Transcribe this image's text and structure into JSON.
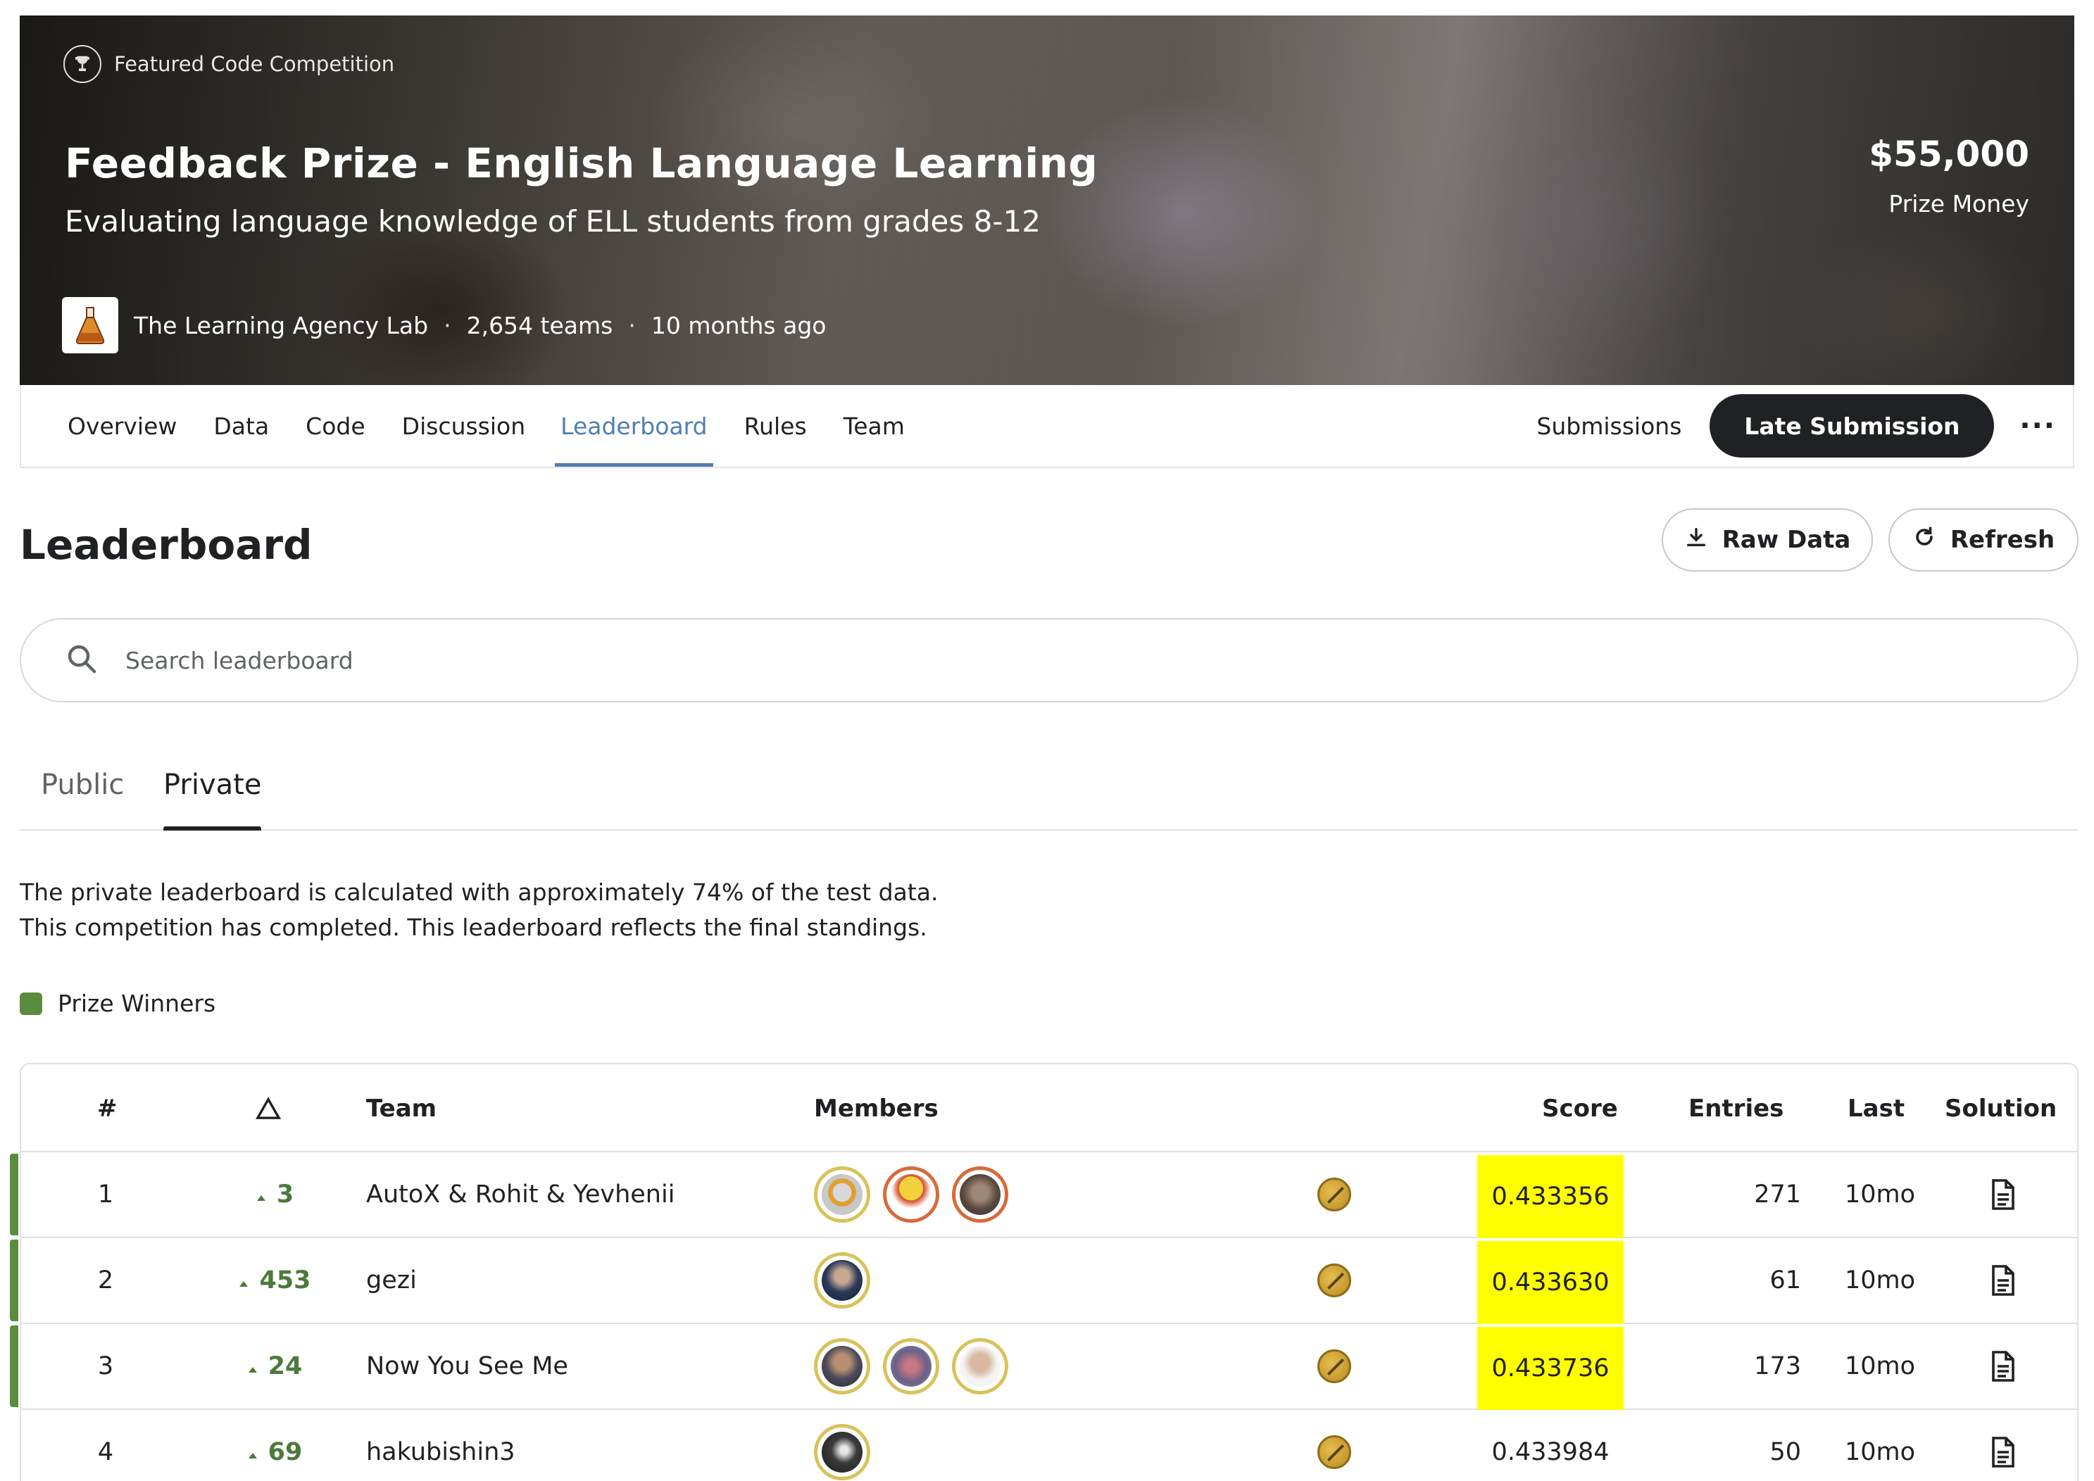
{
  "hero": {
    "badge": "Featured Code Competition",
    "title": "Feedback Prize - English Language Learning",
    "subtitle": "Evaluating language knowledge of ELL students from grades 8-12",
    "host": "The Learning Agency Lab",
    "teams": "2,654 teams",
    "time": "10 months ago",
    "prize_amount": "$55,000",
    "prize_label": "Prize Money"
  },
  "nav": {
    "tabs": [
      "Overview",
      "Data",
      "Code",
      "Discussion",
      "Leaderboard",
      "Rules",
      "Team"
    ],
    "active_tab": "Leaderboard",
    "submissions": "Submissions",
    "late_submission": "Late Submission",
    "more": "···"
  },
  "leaderboard": {
    "title": "Leaderboard",
    "raw_data": "Raw Data",
    "refresh": "Refresh",
    "search_placeholder": "Search leaderboard",
    "tabs": [
      "Public",
      "Private"
    ],
    "active_tab": "Private",
    "info_line1": "The private leaderboard is calculated with approximately 74% of the test data.",
    "info_line2": "This competition has completed. This leaderboard reflects the final standings.",
    "legend_label": "Prize Winners"
  },
  "colors": {
    "accent": "#4f7fb0",
    "prize_green": "#5b8c3e",
    "highlight": "#ffff00",
    "gold": "#d9c25a"
  },
  "table": {
    "headers": {
      "rank": "#",
      "delta": "△",
      "team": "Team",
      "members": "Members",
      "score": "Score",
      "entries": "Entries",
      "last": "Last",
      "solution": "Solution"
    },
    "rows": [
      {
        "rank": "1",
        "delta": "3",
        "team": "AutoX & Rohit & Yevhenii",
        "score": "0.433356",
        "entries": "271",
        "last": "10mo"
      },
      {
        "rank": "2",
        "delta": "453",
        "team": "gezi",
        "score": "0.433630",
        "entries": "61",
        "last": "10mo"
      },
      {
        "rank": "3",
        "delta": "24",
        "team": "Now You See Me",
        "score": "0.433736",
        "entries": "173",
        "last": "10mo"
      },
      {
        "rank": "4",
        "delta": "69",
        "team": "hakubishin3",
        "score": "0.433984",
        "entries": "50",
        "last": "10mo"
      }
    ]
  }
}
